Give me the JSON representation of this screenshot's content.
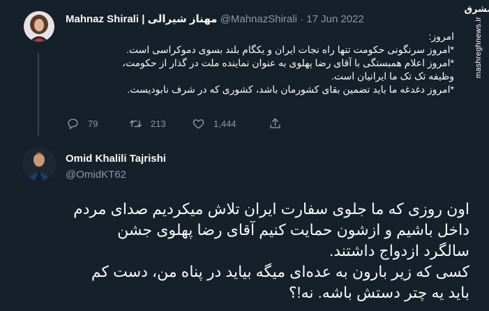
{
  "tweet1": {
    "author_name": "Mahnaz Shirali | مهناز شیرالی",
    "handle": "@MahnazShirali",
    "separator": "·",
    "date": "17 Jun 2022",
    "lines": [
      "امروز:",
      "*امروز سرنگونی حکومت تنها راه نجات ایران و یکگام بلند بسوی دموکراسی است.",
      "*امروز اعلام همبستگی با آقای رضا پهلوی به عنوان نماینده ملت در گذار از حکومت،",
      "وظیفه تک تک ما ایرانیان است.",
      "*امروز دغدغه ما باید تضمین بقای کشورمان باشد، کشوری که در شرف نابودیست."
    ],
    "actions": {
      "reply_count": "79",
      "retweet_count": "213",
      "like_count": "1,444"
    }
  },
  "tweet2": {
    "author_name": "Omid Khalili Tajrishi",
    "handle": "@OmidKT62",
    "lines": [
      "اون روزی که ما جلوی سفارت ایران تلاش میکردیم صدای مردم",
      "داخل باشیم و ازشون حمایت کنیم آقای رضا پهلوی جشن",
      "سالگرد ازدواج داشتند.",
      "کسی که زیر بارون به عده‌ای میگه بیاید در پناه من، دست کم",
      "باید یه چتر دستش باشه. نه!؟"
    ]
  },
  "watermark": {
    "logo": "مشرق",
    "site": "mashreghnews.ir"
  },
  "colors": {
    "background": "#15202b",
    "text": "#f7f9f9",
    "muted": "#8b98a5",
    "thread_line": "#38444d"
  }
}
